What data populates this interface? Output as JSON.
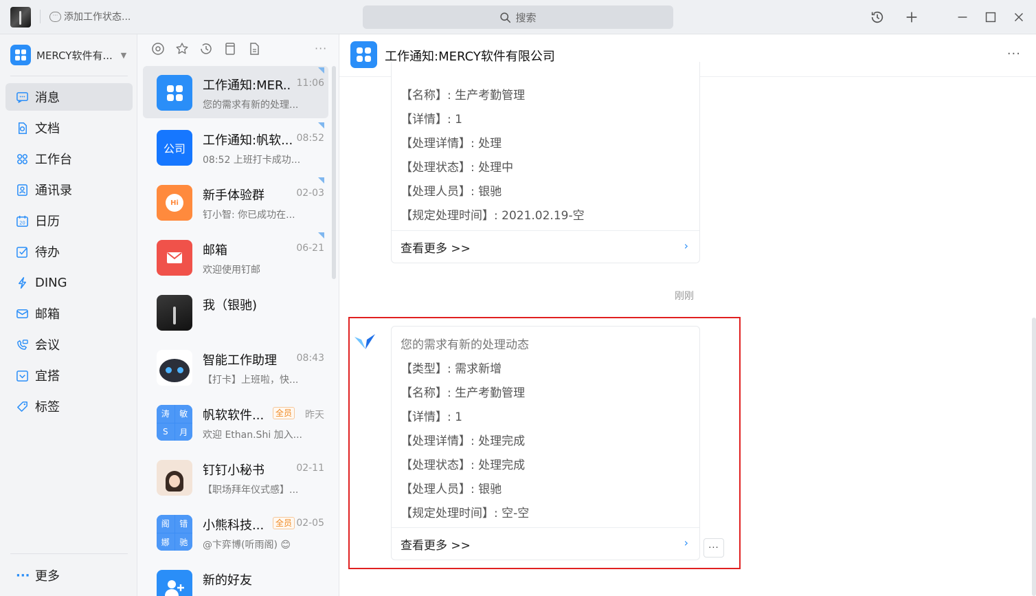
{
  "titlebar": {
    "status_text": "添加工作状态...",
    "search_placeholder": "搜索"
  },
  "org": {
    "name": "MERCY软件有..."
  },
  "nav": [
    {
      "label": "消息",
      "icon": "chat-icon"
    },
    {
      "label": "文档",
      "icon": "document-icon"
    },
    {
      "label": "工作台",
      "icon": "grid-icon"
    },
    {
      "label": "通讯录",
      "icon": "contacts-icon"
    },
    {
      "label": "日历",
      "icon": "calendar-icon"
    },
    {
      "label": "待办",
      "icon": "todo-icon"
    },
    {
      "label": "DING",
      "icon": "lightning-icon"
    },
    {
      "label": "邮箱",
      "icon": "mail-icon"
    },
    {
      "label": "会议",
      "icon": "meeting-icon"
    },
    {
      "label": "宜搭",
      "icon": "yida-icon"
    },
    {
      "label": "标签",
      "icon": "tag-icon"
    }
  ],
  "nav_more": "更多",
  "conversations": [
    {
      "name": "工作通知:MER...",
      "time": "11:06",
      "preview": "您的需求有新的处理..."
    },
    {
      "name": "工作通知:帆软...",
      "time": "08:52",
      "preview": "08:52 上班打卡成功...",
      "avatar_text": "公司"
    },
    {
      "name": "新手体验群",
      "time": "02-03",
      "preview": "钉小智: 你已成功在..."
    },
    {
      "name": "邮箱",
      "time": "06-21",
      "preview": "欢迎使用钉邮"
    },
    {
      "name": "我（银驰)",
      "time": "",
      "preview": ""
    },
    {
      "name": "智能工作助理",
      "time": "08:43",
      "preview": "【打卡】上班啦，快..."
    },
    {
      "name": "帆软软件...",
      "badge": "全员",
      "time": "昨天",
      "preview": "欢迎 Ethan.Shi 加入...",
      "grid": [
        "涛",
        "敏",
        "S",
        "月"
      ]
    },
    {
      "name": "钉钉小秘书",
      "time": "02-11",
      "preview": "【职场拜年仪式感】..."
    },
    {
      "name": "小熊科技...",
      "badge": "全员",
      "time": "02-05",
      "preview": "@卞弈博(听雨阁) 😊",
      "grid": [
        "阁",
        "错",
        "娜",
        "驰"
      ]
    },
    {
      "name": "新的好友",
      "time": "",
      "preview": ""
    }
  ],
  "chat": {
    "title": "工作通知:MERCY软件有限公司",
    "card1": {
      "lines": [
        "【名称】: 生产考勤管理",
        "【详情】: 1",
        "【处理详情】: 处理",
        "【处理状态】: 处理中",
        "【处理人员】: 银驰",
        "【规定处理时间】: 2021.02.19-空"
      ],
      "more": "查看更多 >>"
    },
    "timestamp": "刚刚",
    "card2": {
      "lines": [
        "您的需求有新的处理动态",
        "【类型】: 需求新增",
        "【名称】: 生产考勤管理",
        "【详情】: 1",
        "【处理详情】: 处理完成",
        "【处理状态】: 处理完成",
        "【处理人员】: 银驰",
        "【规定处理时间】: 空-空"
      ],
      "more": "查看更多 >>"
    }
  },
  "colors": {
    "accent": "#2a8ef8",
    "highlight": "#e02020"
  }
}
